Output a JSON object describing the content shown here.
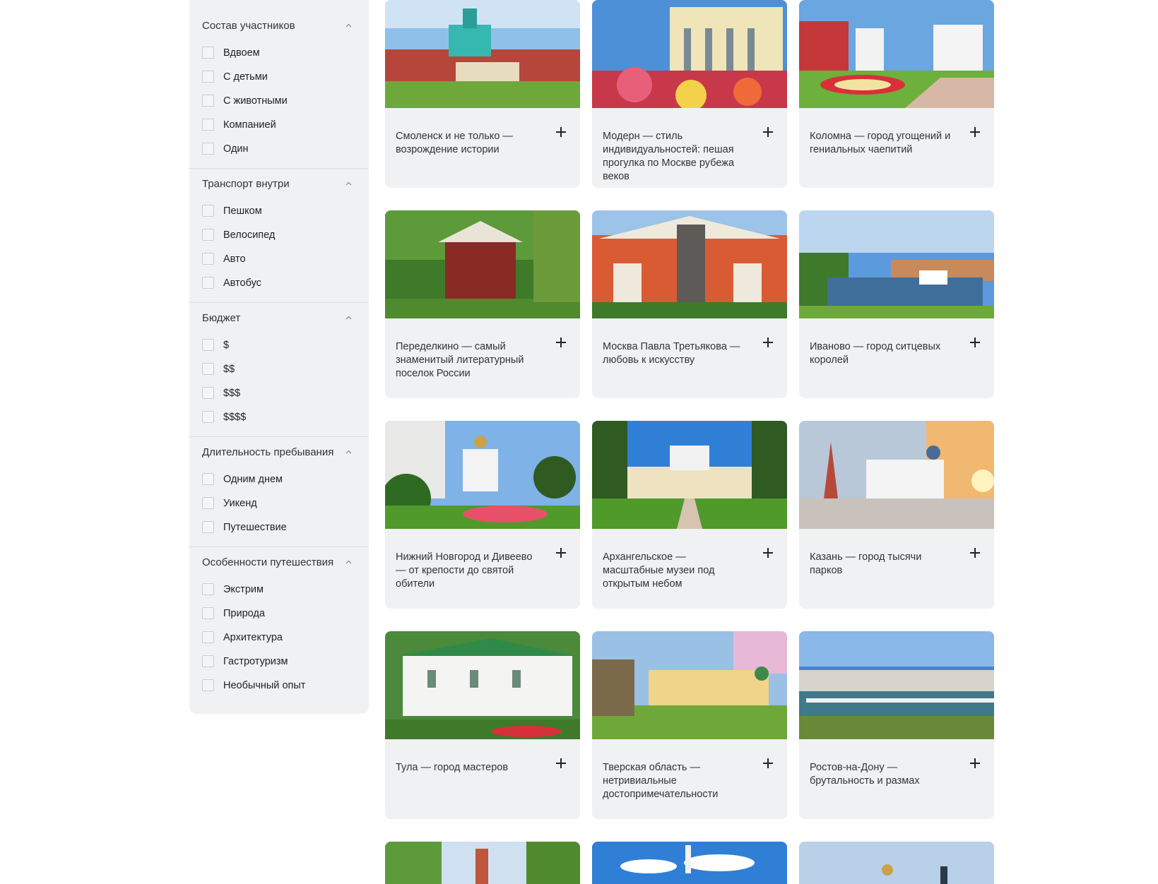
{
  "filters": [
    {
      "title": "Состав участников",
      "options": [
        "Вдвоем",
        "С детьми",
        "С животными",
        "Компанией",
        "Один"
      ]
    },
    {
      "title": "Транспорт внутри",
      "options": [
        "Пешком",
        "Велосипед",
        "Авто",
        "Автобус"
      ]
    },
    {
      "title": "Бюджет",
      "options": [
        "$",
        "$$",
        "$$$",
        "$$$$"
      ]
    },
    {
      "title": "Длительность пребывания",
      "options": [
        "Одним днем",
        "Уикенд",
        "Путешествие"
      ]
    },
    {
      "title": "Особенности путешествия",
      "options": [
        "Экстрим",
        "Природа",
        "Архитектура",
        "Гастротуризм",
        "Необычный опыт"
      ]
    }
  ],
  "cards": [
    {
      "title": "Смоленск и не только — возрождение истории"
    },
    {
      "title": "Модерн — стиль индивидуальностей: пешая прогулка по Москве рубежа веков"
    },
    {
      "title": "Коломна — город угощений и гениальных чаепитий"
    },
    {
      "title": "Переделкино — самый знаменитый литературный поселок России"
    },
    {
      "title": "Москва Павла Третьякова — любовь к искусству"
    },
    {
      "title": "Иваново — город ситцевых королей"
    },
    {
      "title": "Нижний Новгород и Дивеево — от крепости до святой обители"
    },
    {
      "title": "Архангельское — масштабные музеи под открытым небом"
    },
    {
      "title": "Казань — город тысячи парков"
    },
    {
      "title": "Тула — город мастеров"
    },
    {
      "title": "Тверская область — нетривиальные достопримечательности"
    },
    {
      "title": "Ростов-на-Дону — брутальность и размах"
    }
  ],
  "icons": {
    "collapse": "chevron-up-icon",
    "add": "plus-icon"
  }
}
